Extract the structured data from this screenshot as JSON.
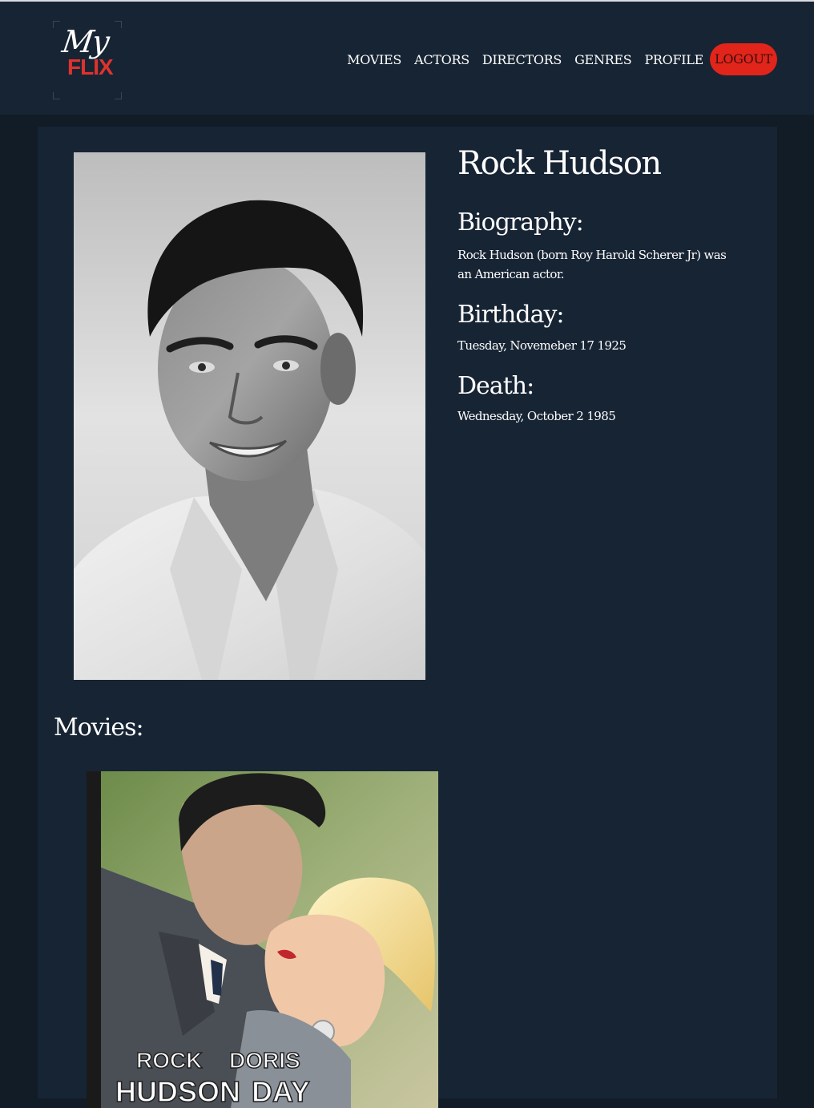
{
  "brand": {
    "logo_top": "My",
    "logo_bottom": "FLIX"
  },
  "nav": {
    "items": [
      "MOVIES",
      "ACTORS",
      "DIRECTORS",
      "GENRES",
      "PROFILE"
    ],
    "logout": "LOGOUT"
  },
  "actor": {
    "name": "Rock Hudson",
    "biography_heading": "Biography:",
    "biography": "Rock Hudson (born Roy Harold Scherer Jr) was an American actor.",
    "birthday_heading": "Birthday:",
    "birthday": "Tuesday, Novemeber 17 1925",
    "death_heading": "Death:",
    "death": "Wednesday, October 2 1985",
    "photo_alt": "Rock Hudson portrait"
  },
  "movies": {
    "heading": "Movies:",
    "items": [
      {
        "poster_text_left_1": "ROCK",
        "poster_text_left_2": "HUDSON",
        "poster_text_right_1": "DORIS",
        "poster_text_right_2": "DAY"
      }
    ]
  },
  "colors": {
    "navbar_bg": "#172434",
    "page_bg": "#111c27",
    "accent": "#e1251b"
  }
}
